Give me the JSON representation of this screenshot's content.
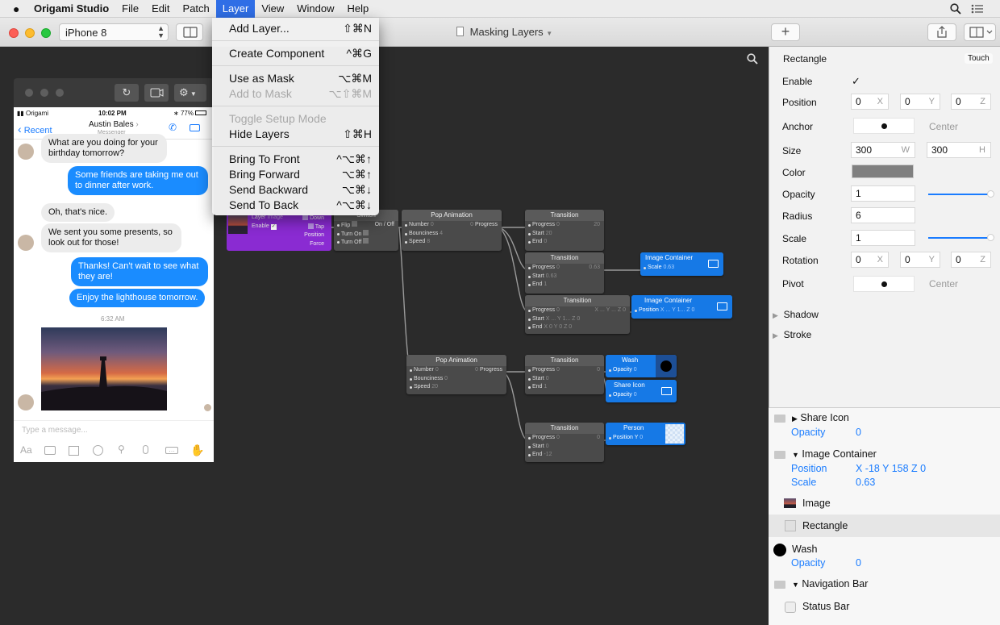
{
  "menubar": {
    "apple": "",
    "app": "Origami Studio",
    "items": [
      "File",
      "Edit",
      "Patch",
      "Layer",
      "View",
      "Window",
      "Help"
    ]
  },
  "toolbar": {
    "device": "iPhone 8",
    "doc_title": "Masking Layers"
  },
  "layer_menu": [
    {
      "label": "Add Layer...",
      "shortcut": "⇧⌘N",
      "enabled": true
    },
    {
      "sep": true
    },
    {
      "label": "Create Component",
      "shortcut": "^⌘G",
      "enabled": true
    },
    {
      "sep": true
    },
    {
      "label": "Use as Mask",
      "shortcut": "⌥⌘M",
      "enabled": true
    },
    {
      "label": "Add to Mask",
      "shortcut": "⌥⇧⌘M",
      "enabled": false
    },
    {
      "sep": true
    },
    {
      "label": "Toggle Setup Mode",
      "shortcut": "",
      "enabled": false
    },
    {
      "label": "Hide Layers",
      "shortcut": "⇧⌘H",
      "enabled": true
    },
    {
      "sep": true
    },
    {
      "label": "Bring To Front",
      "shortcut": "^⌥⌘↑",
      "enabled": true
    },
    {
      "label": "Bring Forward",
      "shortcut": "⌥⌘↑",
      "enabled": true
    },
    {
      "label": "Send Backward",
      "shortcut": "⌥⌘↓",
      "enabled": true
    },
    {
      "label": "Send To Back",
      "shortcut": "^⌥⌘↓",
      "enabled": true
    }
  ],
  "phone": {
    "carrier": "Origami",
    "time": "10:02 PM",
    "battery": "77%",
    "back": "Recent",
    "contact": "Austin Bales",
    "sub": "Messenger",
    "messages": [
      {
        "from": "them",
        "text": "What are you doing for your birthday tomorrow?"
      },
      {
        "from": "me",
        "text": "Some friends are taking me out to dinner after work."
      },
      {
        "from": "them",
        "text": "Oh, that's nice."
      },
      {
        "from": "them",
        "text": "We sent you some presents, so look out for those!"
      },
      {
        "from": "me",
        "text": "Thanks! Can't wait to see what they are!"
      },
      {
        "from": "me",
        "text": "Enjoy the lighthouse tomorrow."
      }
    ],
    "stamp": "6:32 AM",
    "placeholder": "Type a message..."
  },
  "patches": {
    "layer": {
      "r1": "Layer",
      "r1v": "Image",
      "r2": "Enable",
      "down": "Down",
      "tap": "Tap",
      "position": "Position",
      "force": "Force"
    },
    "switch": {
      "title": "Switch",
      "flip": "Flip",
      "onoff": "On / Off",
      "turnon": "Turn On",
      "turnoff": "Turn Off"
    },
    "pop1": {
      "title": "Pop Animation",
      "number": "Number",
      "numv": "0",
      "bounciness": "Bounciness",
      "bv": "4",
      "speed": "Speed",
      "sv": "8",
      "out": "Progress",
      "outv": "0"
    },
    "t1": {
      "title": "Transition",
      "progress": "Progress",
      "pv": "0",
      "start": "Start",
      "stv": "20",
      "end": "End",
      "ev": "0",
      "out": "20"
    },
    "t2": {
      "title": "Transition",
      "progress": "Progress",
      "pv": "0",
      "start": "Start",
      "stv": "0.63",
      "end": "End",
      "ev": "1",
      "out": "0.63"
    },
    "t3": {
      "title": "Transition",
      "progress": "Progress",
      "pv": "0",
      "start": "Start",
      "startv": "X ... Y 1... Z 0",
      "end": "End",
      "endv": "X 0 Y 0 Z 0",
      "out": "X ... Y ... Z 0"
    },
    "ic1": {
      "title": "Image Container",
      "prop": "Scale",
      "v": "0.63"
    },
    "ic2": {
      "title": "Image Container",
      "prop": "Position",
      "v": "X ... Y 1... Z 0"
    },
    "pop2": {
      "title": "Pop Animation",
      "number": "Number",
      "numv": "0",
      "bounciness": "Bounciness",
      "bv": "0",
      "speed": "Speed",
      "sv": "20",
      "out": "Progress",
      "outv": "0"
    },
    "t4": {
      "title": "Transition",
      "progress": "Progress",
      "pv": "0",
      "start": "Start",
      "stv": "0",
      "end": "End",
      "ev": "1",
      "out": "0"
    },
    "wash": {
      "title": "Wash",
      "prop": "Opacity",
      "v": "0"
    },
    "share": {
      "title": "Share Icon",
      "prop": "Opacity",
      "v": "0"
    },
    "t5": {
      "title": "Transition",
      "progress": "Progress",
      "pv": "0",
      "start": "Start",
      "stv": "0",
      "end": "End",
      "ev": "-12",
      "out": "0"
    },
    "person": {
      "title": "Person",
      "prop": "Position Y",
      "v": "0"
    }
  },
  "inspector": {
    "title": "Rectangle",
    "touch": "Touch",
    "enable_label": "Enable",
    "enable": "✓",
    "position_label": "Position",
    "pos": [
      "0",
      "0",
      "0"
    ],
    "anchor_label": "Anchor",
    "anchor": "Center",
    "size_label": "Size",
    "size_w": "300",
    "size_h": "300",
    "color_label": "Color",
    "color": "#808080",
    "opacity_label": "Opacity",
    "opacity": "1",
    "opacity_level": 1,
    "radius_label": "Radius",
    "radius": "6",
    "scale_label": "Scale",
    "scale": "1",
    "scale_level": 1,
    "rotation_label": "Rotation",
    "rot": [
      "0",
      "0",
      "0"
    ],
    "pivot_label": "Pivot",
    "pivot": "Center",
    "shadow": "Shadow",
    "stroke": "Stroke",
    "axis": {
      "x": "X",
      "y": "Y",
      "z": "Z",
      "w": "W",
      "h": "H"
    }
  },
  "layers": [
    {
      "name": "Share Icon",
      "props": [
        [
          "Opacity",
          "0"
        ]
      ]
    },
    {
      "name": "Image Container",
      "props": [
        [
          "Position",
          "X -18 Y 158 Z 0"
        ],
        [
          "Scale",
          "0.63"
        ]
      ]
    },
    {
      "name": "Image"
    },
    {
      "name": "Rectangle"
    },
    {
      "name": "Wash",
      "props": [
        [
          "Opacity",
          "0"
        ]
      ]
    },
    {
      "name": "Navigation Bar"
    },
    {
      "name": "Status Bar"
    }
  ]
}
